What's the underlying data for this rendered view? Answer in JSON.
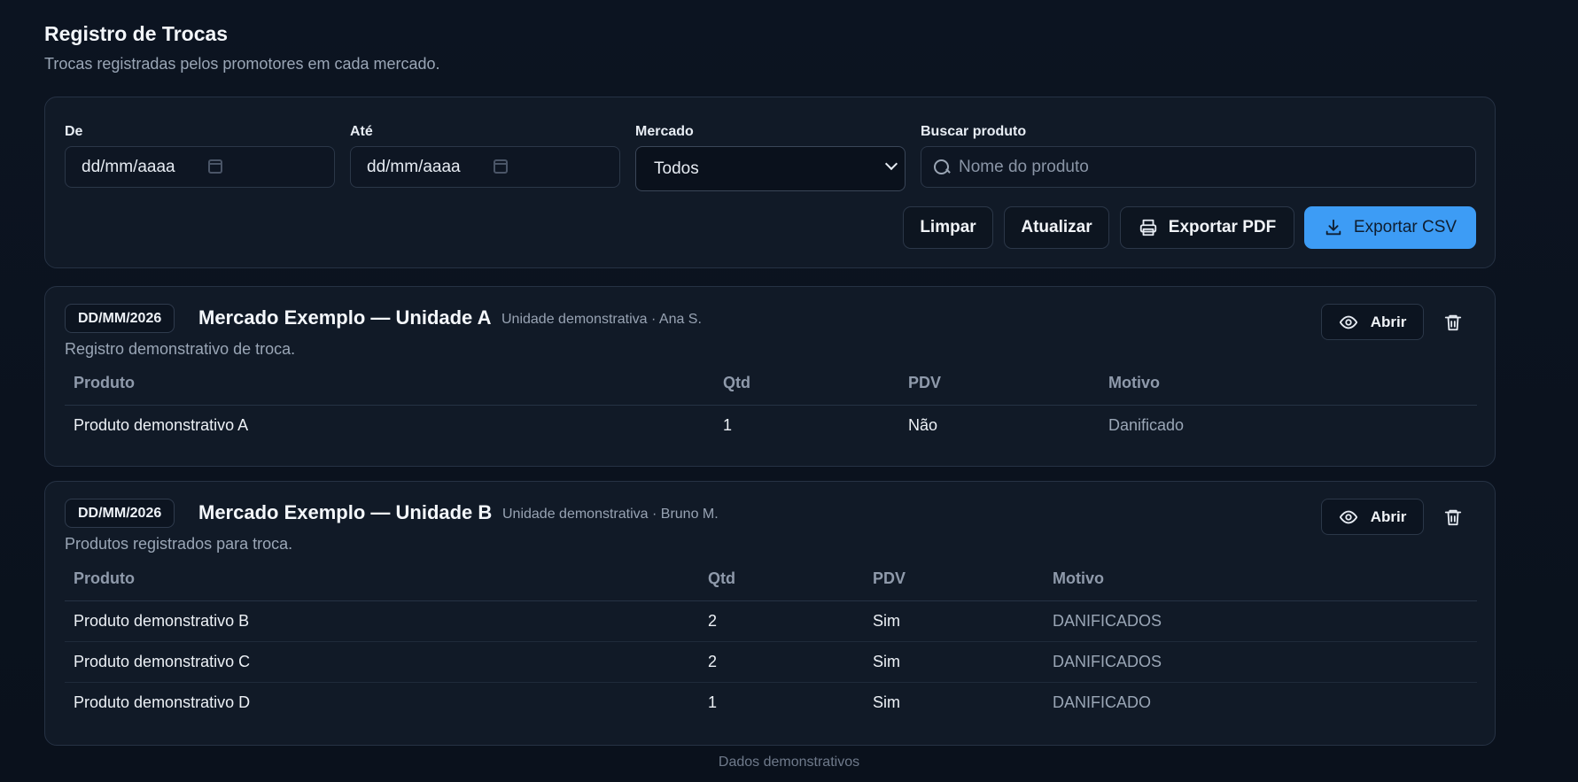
{
  "header": {
    "title": "Registro de Trocas",
    "subtitle": "Trocas registradas pelos promotores em cada mercado."
  },
  "filters": {
    "from_label": "De",
    "from_value": "dd/mm/aaaa",
    "to_label": "Até",
    "to_value": "dd/mm/aaaa",
    "market_label": "Mercado",
    "market_value": "Todos",
    "search_label": "Buscar produto",
    "search_placeholder": "Nome do produto",
    "buttons": {
      "clear": "Limpar",
      "refresh": "Atualizar",
      "export_pdf": "Exportar PDF",
      "export_csv": "Exportar CSV"
    }
  },
  "records": [
    {
      "date": "DD/MM/2026",
      "market": "Mercado Exemplo — Unidade A",
      "unit": "Unidade demonstrativa",
      "separator": "·",
      "promoter": "Ana S.",
      "description": "Registro demonstrativo de troca.",
      "open_label": "Abrir",
      "columns": [
        "Produto",
        "Qtd",
        "PDV",
        "Motivo"
      ],
      "rows": [
        [
          "Produto demonstrativo A",
          "1",
          "Não",
          "Danificado"
        ]
      ]
    },
    {
      "date": "DD/MM/2026",
      "market": "Mercado Exemplo — Unidade B",
      "unit": "Unidade demonstrativa",
      "separator": "·",
      "promoter": "Bruno M.",
      "description": "Produtos registrados para troca.",
      "open_label": "Abrir",
      "columns": [
        "Produto",
        "Qtd",
        "PDV",
        "Motivo"
      ],
      "rows": [
        [
          "Produto demonstrativo B",
          "2",
          "Sim",
          "DANIFICADOS"
        ],
        [
          "Produto demonstrativo C",
          "2",
          "Sim",
          "DANIFICADOS"
        ],
        [
          "Produto demonstrativo D",
          "1",
          "Sim",
          "DANIFICADO"
        ]
      ]
    }
  ],
  "footer": "Dados demonstrativos",
  "colors": {
    "background": "#0b1220",
    "card": "#111a27",
    "primary": "#3d9cf5"
  },
  "icons": [
    "calendar-icon",
    "chevron-down-icon",
    "search-icon",
    "printer-icon",
    "download-icon",
    "eye-icon",
    "trash-icon"
  ]
}
